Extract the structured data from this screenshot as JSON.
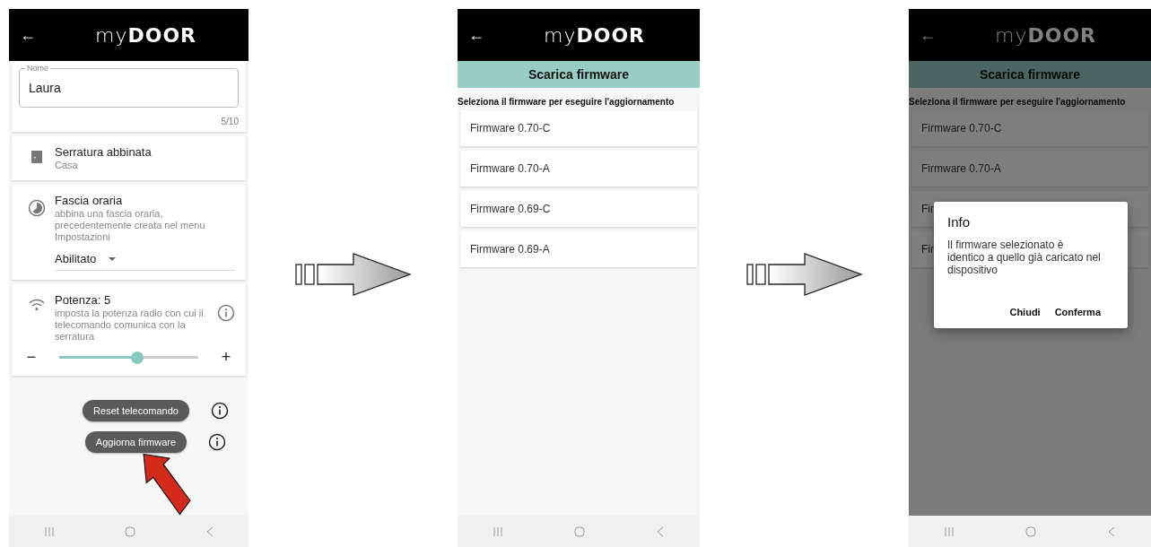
{
  "screens": [
    {
      "kind": "settings",
      "back": "←",
      "logo": "my**DOOR**",
      "name_field": {
        "label": "Nome",
        "value": "Laura",
        "counter": "5/10"
      },
      "paired_lock": {
        "title": "Serratura abbinata",
        "subtitle": "Casa"
      },
      "time_slot": {
        "title": "Fascia oraria",
        "description": "abbina una fascia oraria, precedentemente creata nel menu Impostazioni",
        "dropdown": "Abilitato"
      },
      "power": {
        "title": "Potenza: 5",
        "description": "imposta la potenza radio con cui il telecomando comunica con la serratura",
        "minus": "−",
        "plus": "+",
        "level": 0.56
      },
      "buttons": [
        "Reset telecomando",
        "Aggiorna firmware"
      ]
    },
    {
      "kind": "firmware_list",
      "back": "←",
      "logo": "my**DOOR**",
      "title": "Scarica firmware",
      "instruction": "Seleziona il firmware per eseguire l'aggiornamento",
      "items": [
        "Firmware 0.70-C",
        "Firmware 0.70-A",
        "Firmware 0.69-C",
        "Firmware 0.69-A"
      ]
    },
    {
      "kind": "firmware_list",
      "back": "←",
      "logo": "my**DOOR**",
      "title": "Scarica firmware",
      "instruction": "Seleziona il firmware per eseguire l'aggiornamento",
      "items": [
        "Firmware 0.70-C",
        "Firmware 0.70-A",
        "Fir",
        "Fir"
      ],
      "dialog": {
        "title": "Info",
        "message": "Il firmware selezionato è identico a quello già caricato nel dispositivo",
        "buttons": [
          "Chiudi",
          "Conferma"
        ]
      }
    }
  ]
}
